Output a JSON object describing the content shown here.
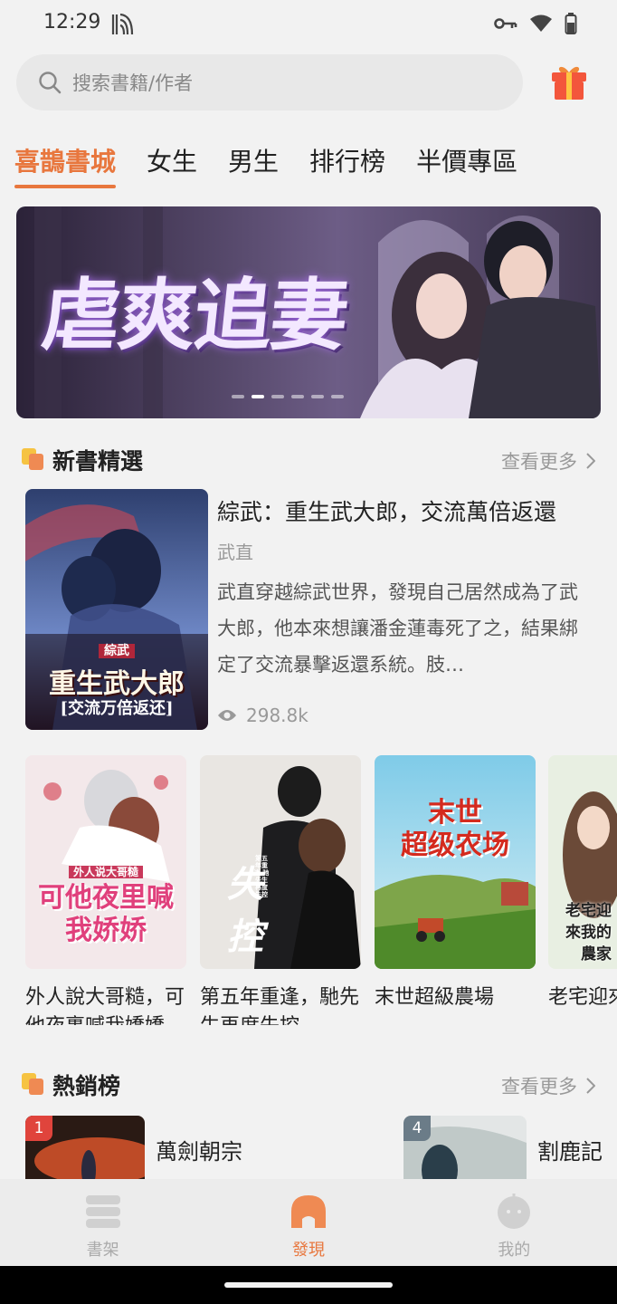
{
  "status": {
    "time": "12:29"
  },
  "search": {
    "placeholder": "搜索書籍/作者"
  },
  "tabs": [
    {
      "label": "喜鵲書城",
      "active": true
    },
    {
      "label": "女生"
    },
    {
      "label": "男生"
    },
    {
      "label": "排行榜"
    },
    {
      "label": "半價專區"
    }
  ],
  "banner": {
    "text": "虐爽追妻",
    "slides": 6,
    "active_slide": 1
  },
  "new_books": {
    "title": "新書精選",
    "more": "查看更多",
    "featured": {
      "title": "綜武：重生武大郎，交流萬倍返還",
      "author": "武直",
      "description": "武直穿越綜武世界，發現自己居然成為了武大郎，他本來想讓潘金蓮毒死了之，結果綁定了交流暴擊返還系統。肢…",
      "views": "298.8k",
      "cover_tag": "綜武",
      "cover_title": "重生武大郎",
      "cover_subtitle": "[交流万倍返还]"
    },
    "books": [
      {
        "title": "外人說大哥糙，可他夜裏喊我嬌嬌",
        "cover_small": "外人说大哥糙",
        "cover_big": "可他夜里喊我娇娇"
      },
      {
        "title": "第五年重逢，馳先生再度失控",
        "cover_big": "失控",
        "cover_small": "第五年重逢 驰先生再度失控"
      },
      {
        "title": "末世超級農場",
        "cover_small": "末世",
        "cover_big": "超级农场"
      },
      {
        "title": "老宅迎來的農家",
        "cover_big": "老宅迎來我的農家"
      }
    ]
  },
  "bestsellers": {
    "title": "熱銷榜",
    "more": "查看更多",
    "items": [
      {
        "rank": "1",
        "title": "萬劍朝宗"
      },
      {
        "rank": "4",
        "title": "割鹿記"
      }
    ]
  },
  "nav": [
    {
      "label": "書架",
      "icon": "bookshelf-icon"
    },
    {
      "label": "發現",
      "icon": "discover-icon",
      "active": true
    },
    {
      "label": "我的",
      "icon": "profile-icon"
    }
  ],
  "colors": {
    "accent": "#e8773e",
    "background": "#f2f2f2"
  }
}
